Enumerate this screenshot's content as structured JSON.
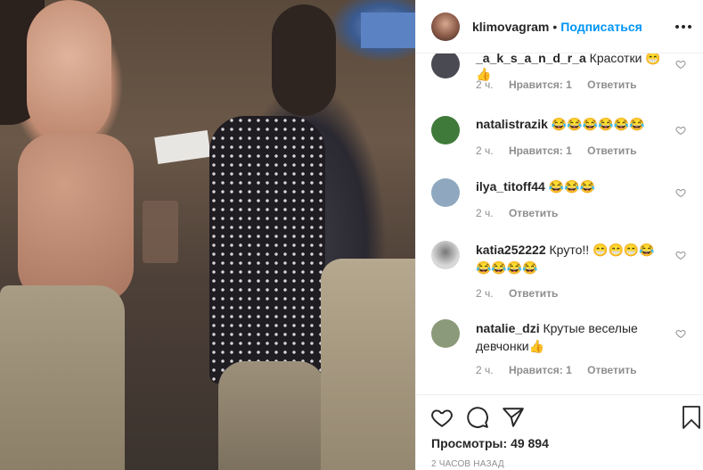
{
  "header": {
    "username": "klimovagram",
    "separator": "•",
    "follow_label": "Подписаться"
  },
  "comments": [
    {
      "username": "_a_k_s_a_n_d_r_a",
      "text": "Красотки 😁👍",
      "time": "2 ч.",
      "likes": "Нравится: 1",
      "reply": "Ответить",
      "avatar_color": "#4a4a52"
    },
    {
      "username": "natalistrazik",
      "text": "😂😂😂😂😂😂",
      "time": "2 ч.",
      "likes": "Нравится: 1",
      "reply": "Ответить",
      "avatar_color": "#3f7a3a"
    },
    {
      "username": "ilya_titoff44",
      "text": "😂😂😂",
      "time": "2 ч.",
      "likes": "",
      "reply": "Ответить",
      "avatar_color": "#8fa8bf"
    },
    {
      "username": "katia252222",
      "text": "Круто!! 😁😁😁😂😂😂😂😂",
      "time": "2 ч.",
      "likes": "",
      "reply": "Ответить",
      "avatar_color": "#d8d8d8"
    },
    {
      "username": "natalie_dzi",
      "text": "Крутые веселые девчонки👍",
      "time": "2 ч.",
      "likes": "Нравится: 1",
      "reply": "Ответить",
      "avatar_color": "#8b9a7a"
    }
  ],
  "actions": {
    "like_icon": "heart-icon",
    "comment_icon": "comment-icon",
    "share_icon": "paper-plane-icon",
    "save_icon": "bookmark-icon"
  },
  "views": {
    "label": "Просмотры:",
    "value": "49 894"
  },
  "timestamp": "2 ЧАСОВ НАЗАД"
}
